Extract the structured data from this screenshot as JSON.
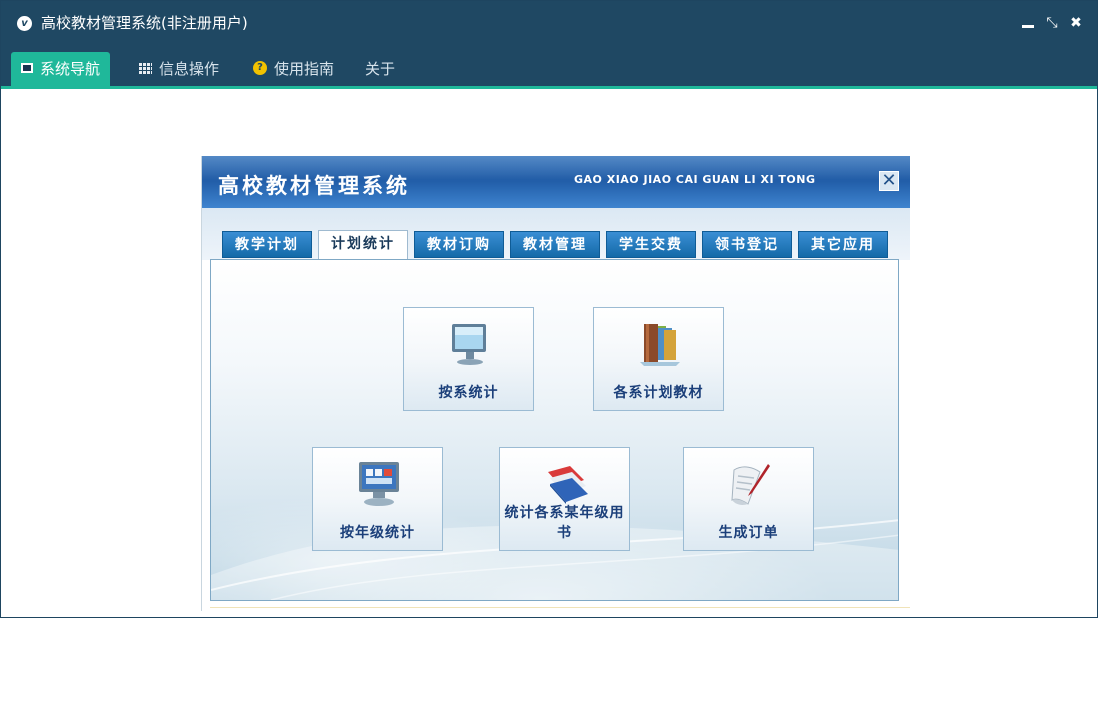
{
  "window": {
    "title": "高校教材管理系统(非注册用户)",
    "logo_letter": "v",
    "controls": {
      "restore": "⤡",
      "close": "✖"
    }
  },
  "menu": {
    "items": [
      {
        "label": "系统导航",
        "icon": "monitor-icon",
        "active": true
      },
      {
        "label": "信息操作",
        "icon": "grid-icon"
      },
      {
        "label": "使用指南",
        "icon": "help-icon"
      },
      {
        "label": "关于"
      }
    ]
  },
  "panel": {
    "title": "高校教材管理系统",
    "subtitle": "GAO XIAO JIAO CAI GUAN LI XI TONG",
    "close_glyph": "✕",
    "tabs": [
      "教学计划",
      "计划统计",
      "教材订购",
      "教材管理",
      "学生交费",
      "领书登记",
      "其它应用"
    ],
    "active_tab": "计划统计",
    "functions": [
      {
        "label": "按系统计",
        "icon": "monitor-icon"
      },
      {
        "label": "各系计划教材",
        "icon": "books-icon"
      },
      {
        "label": "按年级统计",
        "icon": "computer-chart-icon"
      },
      {
        "label": "统计各系某年级用书",
        "icon": "folders-icon"
      },
      {
        "label": "生成订单",
        "icon": "scroll-pen-icon"
      }
    ]
  },
  "colors": {
    "titlebar": "#1f4863",
    "accent": "#1fb89a",
    "panel_header": "#1f5ba6",
    "tab": "#146aa8",
    "label": "#1b3f7a"
  }
}
